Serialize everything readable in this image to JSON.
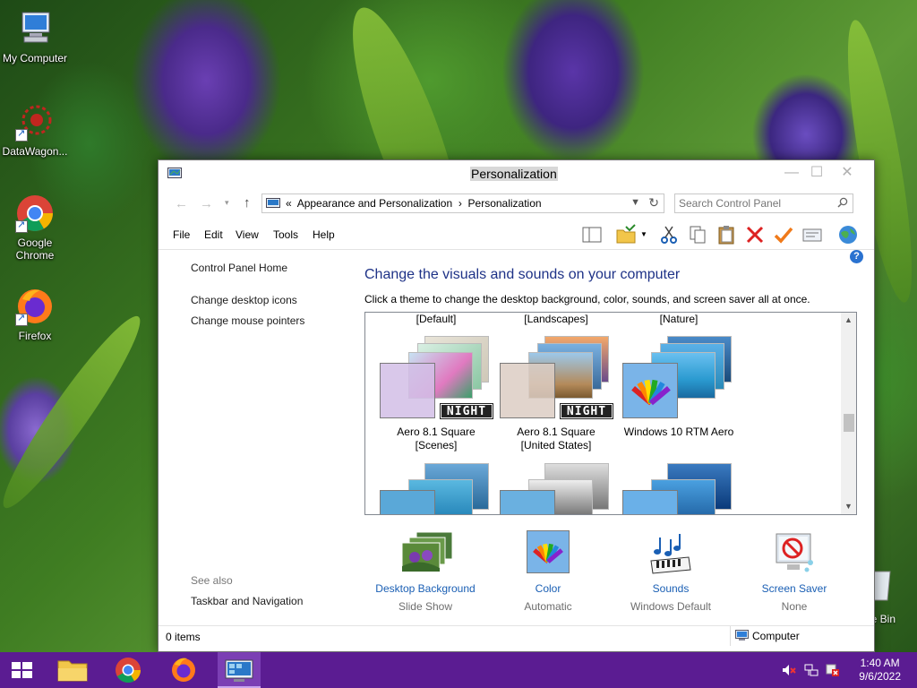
{
  "desktop": {
    "icons": [
      {
        "label": "My Computer"
      },
      {
        "label": "DataWagon..."
      },
      {
        "label": "Google Chrome"
      },
      {
        "label": "Firefox"
      }
    ],
    "recycle_bin_label": "le Bin"
  },
  "window": {
    "title": "Personalization",
    "breadcrumb": {
      "prefix": "«",
      "items": [
        "Appearance and Personalization",
        "Personalization"
      ],
      "separator": "›"
    },
    "search_placeholder": "Search Control Panel",
    "menu": [
      "File",
      "Edit",
      "View",
      "Tools",
      "Help"
    ],
    "left_pane": {
      "home": "Control Panel Home",
      "links": [
        "Change desktop icons",
        "Change mouse pointers"
      ],
      "see_also_label": "See also",
      "see_also_links": [
        "Taskbar and Navigation"
      ]
    },
    "main": {
      "title": "Change the visuals and sounds on your computer",
      "subtitle": "Click a theme to change the desktop background, color, sounds, and screen saver all at once.",
      "groups": [
        "[Default]",
        "[Landscapes]",
        "[Nature]"
      ],
      "themes": [
        {
          "line1": "Aero 8.1 Square",
          "line2": "[Scenes]",
          "badge": "NIGHT"
        },
        {
          "line1": "Aero 8.1 Square",
          "line2": "[United States]",
          "badge": "NIGHT"
        },
        {
          "line1": "Windows 10 RTM Aero",
          "line2": ""
        }
      ]
    },
    "bottom_items": [
      {
        "label": "Desktop Background",
        "sub": "Slide Show"
      },
      {
        "label": "Color",
        "sub": "Automatic"
      },
      {
        "label": "Sounds",
        "sub": "Windows Default"
      },
      {
        "label": "Screen Saver",
        "sub": "None"
      }
    ],
    "status": {
      "items": "0 items",
      "location": "Computer"
    }
  },
  "taskbar": {
    "time": "1:40 AM",
    "date": "9/6/2022"
  },
  "colors": {
    "taskbar": "#5b1c92",
    "link": "#1a5fb4",
    "heading": "#1e3287"
  }
}
